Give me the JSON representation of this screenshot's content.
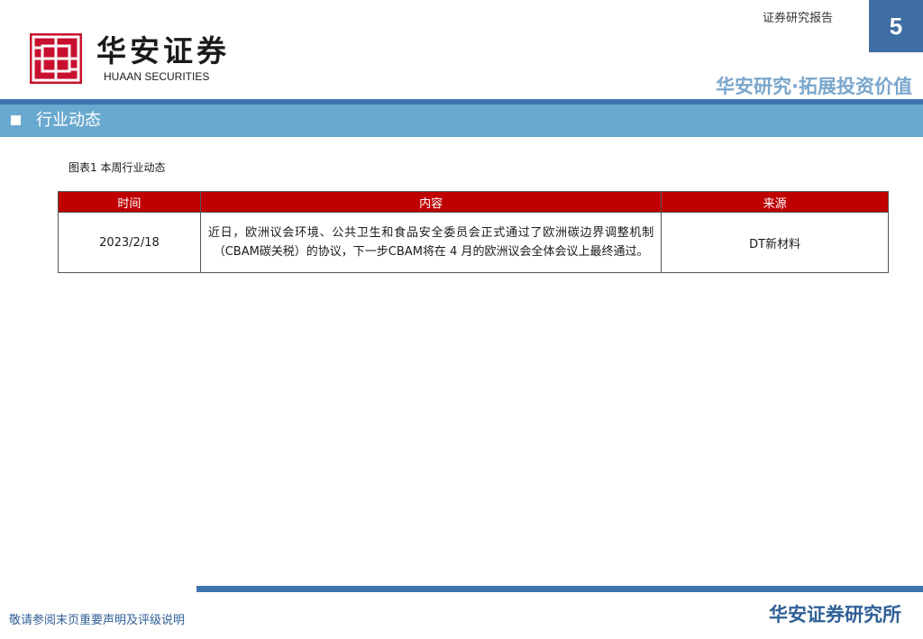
{
  "header": {
    "brand_cn": "华安证券",
    "brand_en": "HUAAN SECURITIES",
    "report_type": "证券研究报告",
    "page_number": "5",
    "slogan": "华安研究·拓展投资价值",
    "colors": {
      "brand_red": "#c8102e",
      "brand_blue": "#3f6ea5",
      "section_bar": "#6aa9cf"
    }
  },
  "section": {
    "title": "行业动态"
  },
  "figure": {
    "caption": "图表1 本周行业动态",
    "table": {
      "headers": [
        "时间",
        "内容",
        "来源"
      ],
      "rows": [
        {
          "date": "2023/2/18",
          "content": "近日，欧洲议会环境、公共卫生和食品安全委员会正式通过了欧洲碳边界调整机制（CBAM碳关税）的协议，下一步CBAM将在 4 月的欧洲议会全体会议上最终通过。",
          "source": "DT新材料"
        }
      ]
    }
  },
  "footer": {
    "disclaimer_link": "敬请参阅末页重要声明及评级说明",
    "institute": "华安证券研究所"
  }
}
